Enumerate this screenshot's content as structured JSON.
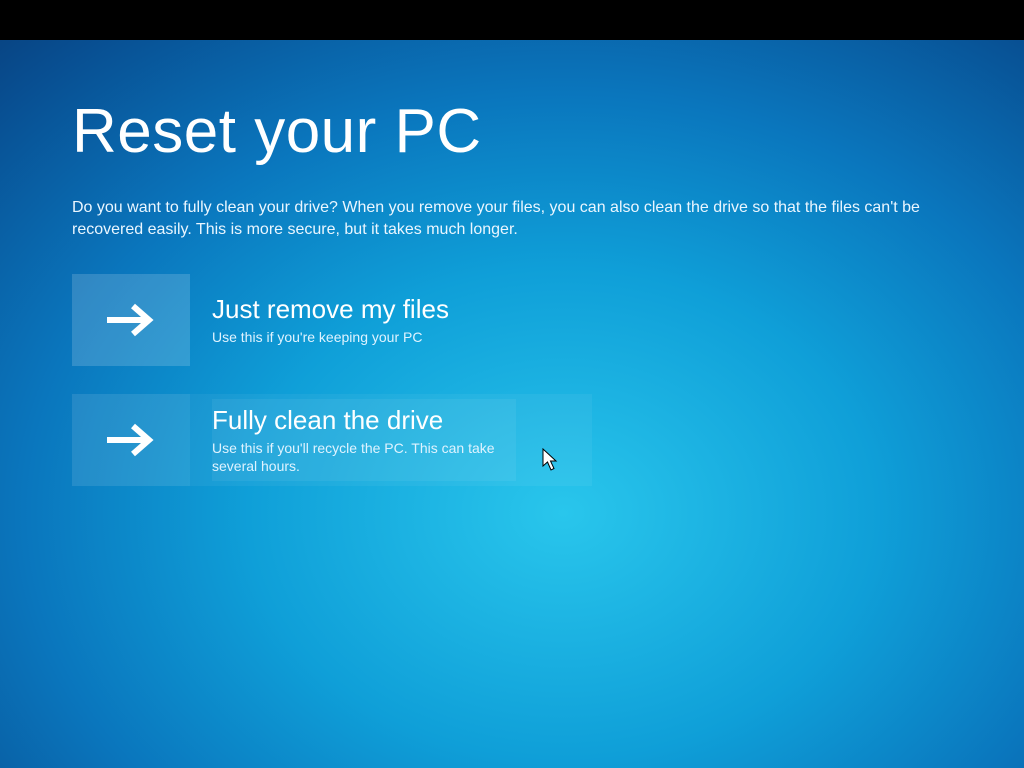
{
  "page": {
    "title": "Reset your PC",
    "description": "Do you want to fully clean your drive? When you remove your files, you can also clean the drive so that the files can't be recovered easily. This is more secure, but it takes much longer."
  },
  "options": [
    {
      "title": "Just remove my files",
      "subtitle": "Use this if you're keeping your PC"
    },
    {
      "title": "Fully clean the drive",
      "subtitle": "Use this if you'll recycle the PC. This can take several hours."
    }
  ]
}
